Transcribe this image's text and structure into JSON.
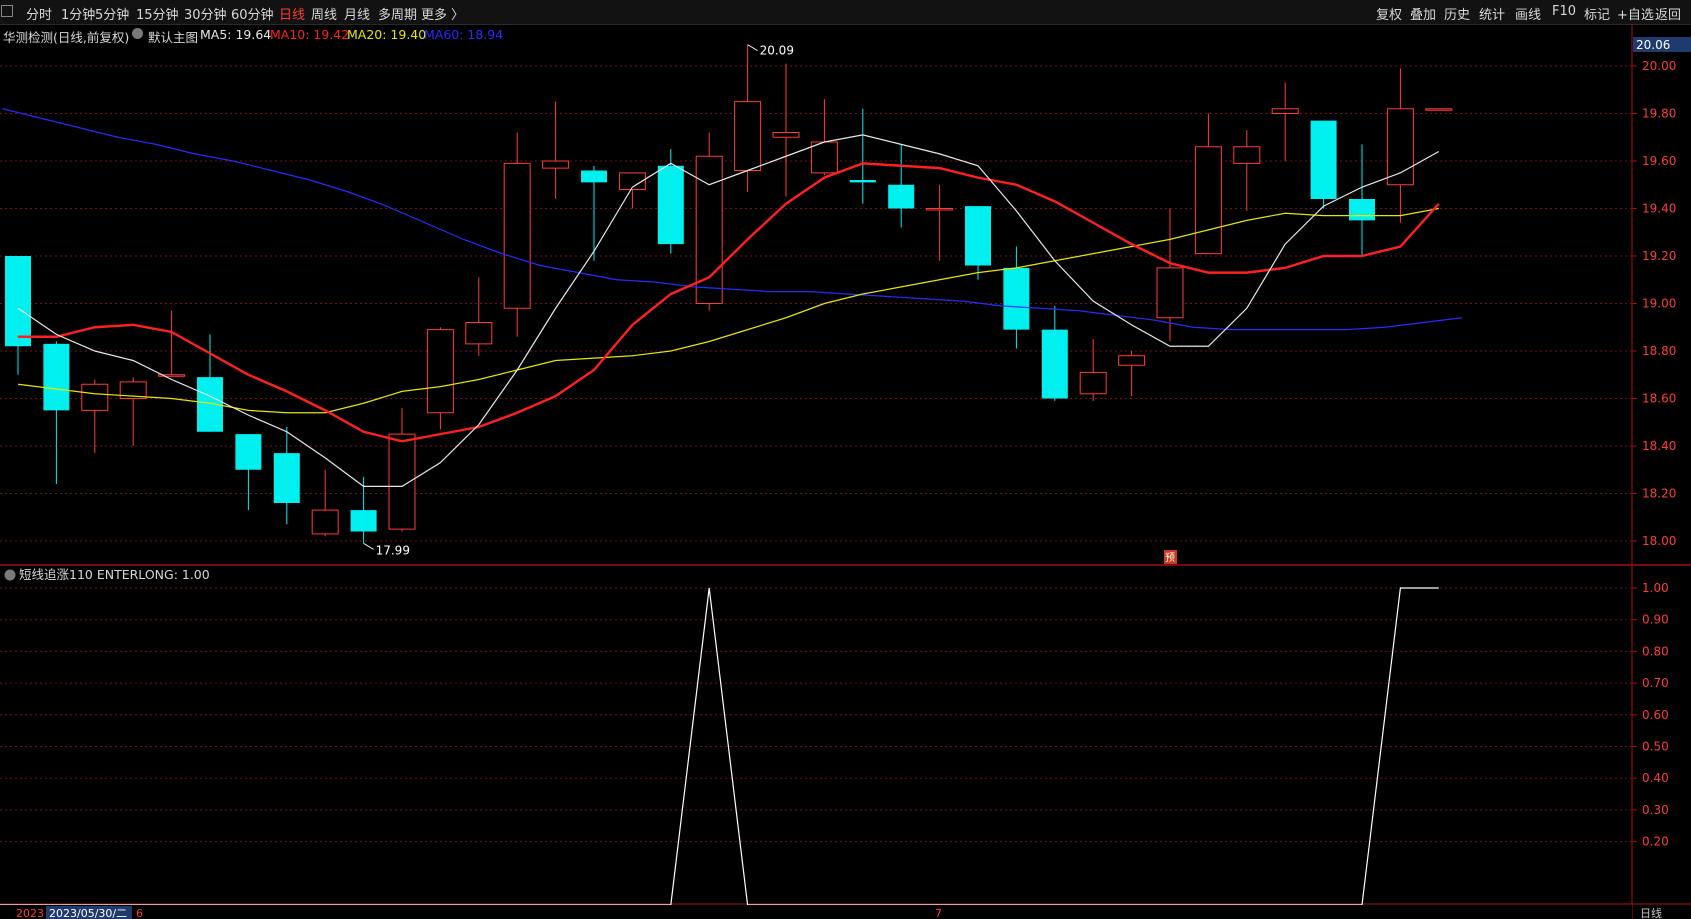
{
  "toolbar": {
    "tabs": [
      {
        "label": "分时",
        "active": false
      },
      {
        "label": "1分钟",
        "active": false
      },
      {
        "label": "5分钟",
        "active": false
      },
      {
        "label": "15分钟",
        "active": false
      },
      {
        "label": "30分钟",
        "active": false
      },
      {
        "label": "60分钟",
        "active": false
      },
      {
        "label": "日线",
        "active": true
      },
      {
        "label": "周线",
        "active": false
      },
      {
        "label": "月线",
        "active": false
      },
      {
        "label": "多周期",
        "active": false
      },
      {
        "label": "更多 〉",
        "active": false
      }
    ],
    "right_buttons": [
      "复权",
      "叠加",
      "历史",
      "统计",
      "画线",
      "F10",
      "标记",
      "+自选",
      "返回"
    ]
  },
  "infobar": {
    "stock": "华测检测(日线,前复权)",
    "template": "默认主图",
    "ma5": "MA5: 19.64",
    "ma10": "MA10: 19.42",
    "ma20": "MA20: 19.40",
    "ma60": "MA60: 18.94",
    "price_tag": "20.06"
  },
  "colors": {
    "up": "#ff3b3b",
    "down": "#00f0f0",
    "ma5": "#e8e8e8",
    "ma10": "#ff2020",
    "ma20": "#e6e600",
    "ma60": "#2a2aff",
    "grid": "#7a1010",
    "indicator": "#ffffff"
  },
  "chart_data": [
    {
      "type": "candlestick",
      "title": "华测检测(日线,前复权)",
      "ylim": [
        17.95,
        20.2
      ],
      "y_ticks": [
        "20.00",
        "19.80",
        "19.60",
        "19.40",
        "19.20",
        "19.00",
        "18.80",
        "18.60",
        "18.40",
        "18.20",
        "18.00"
      ],
      "candles": [
        {
          "o": 19.2,
          "h": 19.2,
          "l": 18.7,
          "c": 18.82
        },
        {
          "o": 18.83,
          "h": 18.84,
          "l": 18.24,
          "c": 18.55
        },
        {
          "o": 18.55,
          "h": 18.68,
          "l": 18.37,
          "c": 18.66
        },
        {
          "o": 18.6,
          "h": 18.69,
          "l": 18.4,
          "c": 18.67
        },
        {
          "o": 18.7,
          "h": 18.97,
          "l": 18.7,
          "c": 18.7
        },
        {
          "o": 18.69,
          "h": 18.87,
          "l": 18.46,
          "c": 18.46
        },
        {
          "o": 18.45,
          "h": 18.45,
          "l": 18.13,
          "c": 18.3
        },
        {
          "o": 18.37,
          "h": 18.48,
          "l": 18.07,
          "c": 18.16
        },
        {
          "o": 18.03,
          "h": 18.3,
          "l": 18.02,
          "c": 18.13
        },
        {
          "o": 18.13,
          "h": 18.27,
          "l": 17.99,
          "c": 18.04
        },
        {
          "o": 18.05,
          "h": 18.56,
          "l": 18.04,
          "c": 18.45
        },
        {
          "o": 18.54,
          "h": 18.9,
          "l": 18.47,
          "c": 18.89
        },
        {
          "o": 18.83,
          "h": 19.11,
          "l": 18.78,
          "c": 18.92
        },
        {
          "o": 18.98,
          "h": 19.72,
          "l": 18.86,
          "c": 19.59
        },
        {
          "o": 19.57,
          "h": 19.85,
          "l": 19.44,
          "c": 19.6
        },
        {
          "o": 19.56,
          "h": 19.58,
          "l": 19.18,
          "c": 19.51
        },
        {
          "o": 19.48,
          "h": 19.55,
          "l": 19.4,
          "c": 19.55
        },
        {
          "o": 19.58,
          "h": 19.65,
          "l": 19.21,
          "c": 19.25
        },
        {
          "o": 19.0,
          "h": 19.72,
          "l": 18.97,
          "c": 19.62
        },
        {
          "o": 19.56,
          "h": 20.09,
          "l": 19.47,
          "c": 19.85
        },
        {
          "o": 19.7,
          "h": 20.01,
          "l": 19.45,
          "c": 19.72
        },
        {
          "o": 19.55,
          "h": 19.86,
          "l": 19.54,
          "c": 19.68
        },
        {
          "o": 19.52,
          "h": 19.82,
          "l": 19.42,
          "c": 19.51
        },
        {
          "o": 19.5,
          "h": 19.67,
          "l": 19.32,
          "c": 19.4
        },
        {
          "o": 19.4,
          "h": 19.5,
          "l": 19.18,
          "c": 19.4
        },
        {
          "o": 19.41,
          "h": 19.41,
          "l": 19.1,
          "c": 19.16
        },
        {
          "o": 19.15,
          "h": 19.24,
          "l": 18.81,
          "c": 18.89
        },
        {
          "o": 18.89,
          "h": 18.99,
          "l": 18.59,
          "c": 18.6
        },
        {
          "o": 18.62,
          "h": 18.85,
          "l": 18.59,
          "c": 18.71
        },
        {
          "o": 18.74,
          "h": 18.8,
          "l": 18.61,
          "c": 18.78
        },
        {
          "o": 18.94,
          "h": 19.4,
          "l": 18.84,
          "c": 19.15
        },
        {
          "o": 19.21,
          "h": 19.8,
          "l": 19.21,
          "c": 19.66
        },
        {
          "o": 19.59,
          "h": 19.73,
          "l": 19.39,
          "c": 19.66
        },
        {
          "o": 19.8,
          "h": 19.93,
          "l": 19.6,
          "c": 19.82
        },
        {
          "o": 19.77,
          "h": 19.77,
          "l": 19.4,
          "c": 19.44
        },
        {
          "o": 19.44,
          "h": 19.67,
          "l": 19.2,
          "c": 19.35
        },
        {
          "o": 19.5,
          "h": 19.99,
          "l": 19.34,
          "c": 19.82
        },
        {
          "o": 19.82,
          "h": 19.82,
          "l": 19.82,
          "c": 19.82
        }
      ],
      "ma5": [
        18.98,
        18.87,
        18.8,
        18.76,
        18.68,
        18.61,
        18.53,
        18.46,
        18.35,
        18.23,
        18.23,
        18.33,
        18.49,
        18.72,
        18.98,
        19.22,
        19.49,
        19.59,
        19.5,
        19.56,
        19.62,
        19.68,
        19.71,
        19.67,
        19.63,
        19.58,
        19.39,
        19.18,
        19.01,
        18.91,
        18.82,
        18.82,
        18.98,
        19.25,
        19.41,
        19.49,
        19.55,
        19.64
      ],
      "ma10": [
        18.86,
        18.86,
        18.9,
        18.91,
        18.88,
        18.79,
        18.7,
        18.63,
        18.55,
        18.46,
        18.42,
        18.45,
        18.48,
        18.54,
        18.61,
        18.72,
        18.91,
        19.04,
        19.11,
        19.27,
        19.42,
        19.53,
        19.59,
        19.58,
        19.57,
        19.53,
        19.5,
        19.43,
        19.34,
        19.25,
        19.17,
        19.13,
        19.13,
        19.15,
        19.2,
        19.2,
        19.24,
        19.42
      ],
      "ma20": [
        18.66,
        18.64,
        18.62,
        18.61,
        18.6,
        18.58,
        18.55,
        18.54,
        18.54,
        18.58,
        18.63,
        18.65,
        18.68,
        18.72,
        18.76,
        18.77,
        18.78,
        18.8,
        18.84,
        18.89,
        18.94,
        19.0,
        19.04,
        19.07,
        19.1,
        19.13,
        19.15,
        19.18,
        19.21,
        19.24,
        19.27,
        19.31,
        19.35,
        19.38,
        19.37,
        19.37,
        19.37,
        19.4
      ],
      "ma60": [
        19.82,
        19.78,
        19.74,
        19.7,
        19.67,
        19.63,
        19.6,
        19.56,
        19.52,
        19.47,
        19.41,
        19.34,
        19.27,
        19.21,
        19.16,
        19.13,
        19.1,
        19.09,
        19.07,
        19.06,
        19.05,
        19.05,
        19.04,
        19.03,
        19.02,
        19.01,
        18.99,
        18.98,
        18.97,
        18.95,
        18.93,
        18.9,
        18.89,
        18.89,
        18.89,
        18.89,
        18.9,
        18.92,
        18.94
      ],
      "annotations": [
        {
          "label": "20.09",
          "index": 19
        },
        {
          "label": "17.99",
          "index": 9
        }
      ]
    },
    {
      "type": "line",
      "title": "短线追涨110 ENTERLONG: 1.00",
      "ylim": [
        0,
        1.03
      ],
      "y_ticks": [
        "1.00",
        "0.90",
        "0.80",
        "0.70",
        "0.60",
        "0.50",
        "0.40",
        "0.30",
        "0.20"
      ],
      "values": [
        0,
        0,
        0,
        0,
        0,
        0,
        0,
        0,
        0,
        0,
        0,
        0,
        0,
        0,
        0,
        0,
        0,
        0,
        1,
        0,
        0,
        0,
        0,
        0,
        0,
        0,
        0,
        0,
        0,
        0,
        0,
        0,
        0,
        0,
        0,
        0,
        1,
        1
      ]
    }
  ],
  "indicator": {
    "title": "短线追涨110 ENTERLONG: 1.00"
  },
  "markers": {
    "pre": "预"
  },
  "dates": {
    "start": "2023",
    "selected": "2023/05/30/二",
    "m1": "6",
    "m2": "7"
  },
  "period_label": "日线"
}
